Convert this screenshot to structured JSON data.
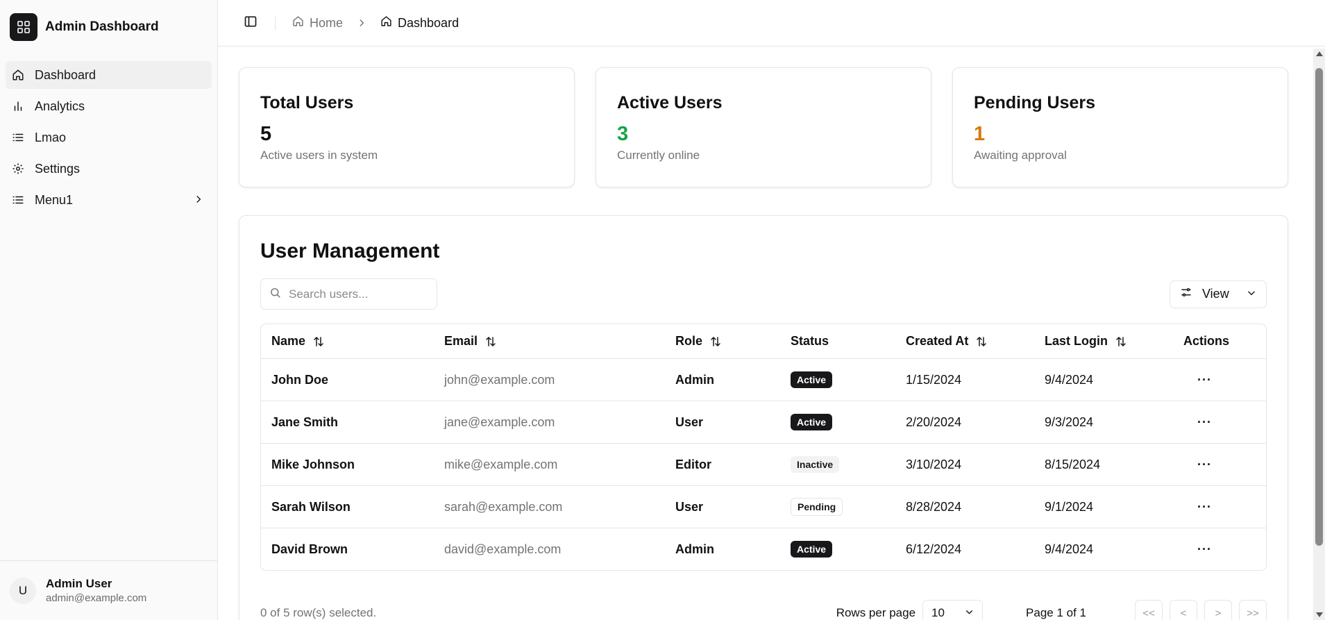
{
  "sidebar": {
    "brand_title": "Admin Dashboard",
    "items": [
      {
        "label": "Dashboard",
        "icon": "home-icon",
        "active": true
      },
      {
        "label": "Analytics",
        "icon": "bar-chart-icon"
      },
      {
        "label": "Lmao",
        "icon": "list-icon"
      },
      {
        "label": "Settings",
        "icon": "gear-icon"
      },
      {
        "label": "Menu1",
        "icon": "list-icon",
        "expandable": true
      }
    ],
    "user": {
      "initial": "U",
      "name": "Admin User",
      "email": "admin@example.com"
    }
  },
  "topbar": {
    "breadcrumb": {
      "home": "Home",
      "current": "Dashboard"
    }
  },
  "stats": [
    {
      "title": "Total Users",
      "value": "5",
      "desc": "Active users in system",
      "color": "#111111"
    },
    {
      "title": "Active Users",
      "value": "3",
      "desc": "Currently online",
      "color": "#16a34a"
    },
    {
      "title": "Pending Users",
      "value": "1",
      "desc": "Awaiting approval",
      "color": "#d97706"
    }
  ],
  "management": {
    "title": "User Management",
    "search_placeholder": "Search users...",
    "view_label": "View",
    "columns": [
      "Name",
      "Email",
      "Role",
      "Status",
      "Created At",
      "Last Login",
      "Actions"
    ],
    "rows": [
      {
        "name": "John Doe",
        "email": "john@example.com",
        "role": "Admin",
        "status": "Active",
        "created": "1/15/2024",
        "last_login": "9/4/2024"
      },
      {
        "name": "Jane Smith",
        "email": "jane@example.com",
        "role": "User",
        "status": "Active",
        "created": "2/20/2024",
        "last_login": "9/3/2024"
      },
      {
        "name": "Mike Johnson",
        "email": "mike@example.com",
        "role": "Editor",
        "status": "Inactive",
        "created": "3/10/2024",
        "last_login": "8/15/2024"
      },
      {
        "name": "Sarah Wilson",
        "email": "sarah@example.com",
        "role": "User",
        "status": "Pending",
        "created": "8/28/2024",
        "last_login": "9/1/2024"
      },
      {
        "name": "David Brown",
        "email": "david@example.com",
        "role": "Admin",
        "status": "Active",
        "created": "6/12/2024",
        "last_login": "9/4/2024"
      }
    ],
    "actions_glyph": "···",
    "footer": {
      "selected": "0 of 5 row(s) selected.",
      "rows_per_page_label": "Rows per page",
      "rows_per_page_value": "10",
      "page_info": "Page 1 of 1",
      "pager": [
        "<<",
        "<",
        ">",
        ">>"
      ]
    }
  }
}
